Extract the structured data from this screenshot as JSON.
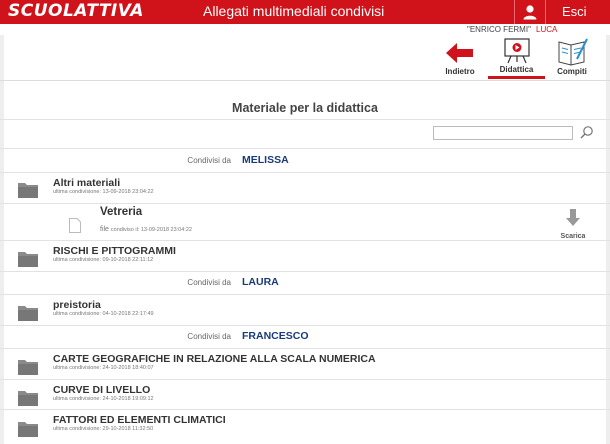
{
  "header": {
    "logo": "SCUOLATTIVA",
    "title": "Allegati multimediali condivisi",
    "logout_label": "Esci",
    "school": "\"ENRICO FERMI\"",
    "user": "LUCA"
  },
  "tabs": [
    {
      "label": "Indietro",
      "icon": "arrow-left-icon"
    },
    {
      "label": "Didattica",
      "icon": "whiteboard-icon",
      "active": true
    },
    {
      "label": "Compiti",
      "icon": "notebook-icon"
    }
  ],
  "page_title": "Materiale per la didattica",
  "search": {
    "placeholder": ""
  },
  "shared_label": "Condivisi da",
  "groups": [
    {
      "shared_by": "MELISSA",
      "items": [
        {
          "type": "folder",
          "title": "Altri materiali",
          "subtitle": "ultima condivisione: 13-09-2018 23:04:22"
        },
        {
          "type": "file",
          "title": "Vetreria",
          "kind": "file",
          "subtitle": "condiviso il: 13-09-2018 23:04:22",
          "action": "Scarica"
        },
        {
          "type": "folder",
          "title": "RISCHI E PITTOGRAMMI",
          "subtitle": "ultima condivisione: 09-10-2018 22:11:12"
        }
      ]
    },
    {
      "shared_by": "LAURA",
      "items": [
        {
          "type": "folder",
          "title": "preistoria",
          "subtitle": "ultima condivisione: 04-10-2018 22:17:49"
        }
      ]
    },
    {
      "shared_by": "FRANCESCO",
      "items": [
        {
          "type": "folder",
          "title": "CARTE GEOGRAFICHE IN RELAZIONE ALLA SCALA NUMERICA",
          "subtitle": "ultima condivisione: 24-10-2018 18:40:07"
        },
        {
          "type": "folder",
          "title": "CURVE DI LIVELLO",
          "subtitle": "ultima condivisione: 24-10-2018 19:09:12"
        },
        {
          "type": "folder",
          "title": "FATTORI ED ELEMENTI CLIMATICI",
          "subtitle": "ultima condivisione: 29-10-2018 11:32:50"
        }
      ]
    }
  ],
  "colors": {
    "brand": "#d0121b",
    "name_blue": "#1a3a7a"
  }
}
